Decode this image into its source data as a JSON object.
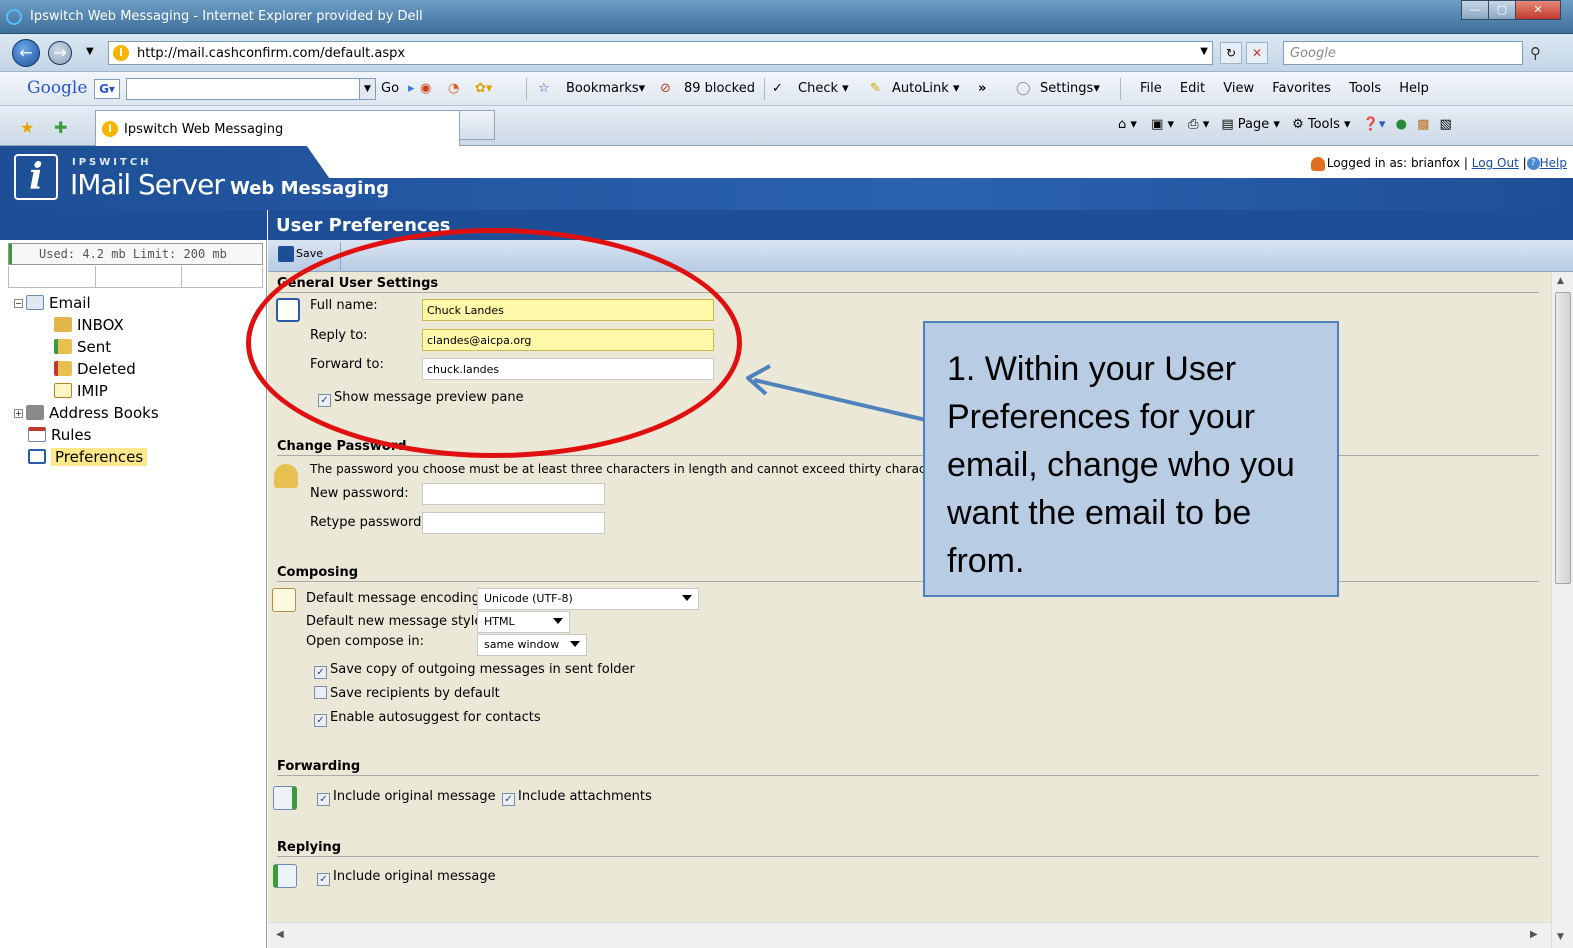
{
  "window": {
    "title": "Ipswitch Web Messaging - Internet Explorer provided by Dell",
    "url": "http://mail.cashconfirm.com/default.aspx",
    "search_placeholder": "Google",
    "tab_label": "Ipswitch Web Messaging"
  },
  "toolbar1": {
    "google_label": "Google",
    "go_label": "Go",
    "bookmarks_label": "Bookmarks",
    "blocked_label": "89 blocked",
    "check_label": "Check",
    "autolink_label": "AutoLink",
    "more_label": "»",
    "settings_label": "Settings",
    "menu": [
      "File",
      "Edit",
      "View",
      "Favorites",
      "Tools",
      "Help"
    ]
  },
  "toolbar2": {
    "page_label": "Page",
    "tools_label": "Tools"
  },
  "app": {
    "brand": "IPSWITCH",
    "product": "IMail Server",
    "subproduct": "Web Messaging",
    "logged_in_label": "Logged in as:",
    "username": "brianfox",
    "logout_label": "Log Out",
    "help_label": "Help"
  },
  "sidebar": {
    "quota_text": "Used: 4.2 mb Limit: 200 mb",
    "tree": [
      {
        "label": "Email",
        "icon": "envelope-icon",
        "level": 0,
        "expander": "−"
      },
      {
        "label": "INBOX",
        "icon": "inbox-icon",
        "level": 1
      },
      {
        "label": "Sent",
        "icon": "sent-folder-icon",
        "level": 1
      },
      {
        "label": "Deleted",
        "icon": "deleted-folder-icon",
        "level": 1
      },
      {
        "label": "IMIP",
        "icon": "folder-icon",
        "level": 1
      },
      {
        "label": "Address Books",
        "icon": "address-book-icon",
        "level": 0,
        "expander": "+"
      },
      {
        "label": "Rules",
        "icon": "rules-icon",
        "level": 0
      },
      {
        "label": "Preferences",
        "icon": "preferences-icon",
        "level": 0,
        "selected": true
      }
    ]
  },
  "main": {
    "title": "User Preferences",
    "save_label": "Save",
    "general": {
      "title": "General User Settings",
      "full_name_label": "Full name:",
      "full_name_value": "Chuck Landes",
      "reply_to_label": "Reply to:",
      "reply_to_value": "clandes@aicpa.org",
      "forward_to_label": "Forward to:",
      "forward_to_value": "chuck.landes",
      "preview_pane_label": "Show message preview pane"
    },
    "password": {
      "title": "Change Password",
      "hint": "The password you choose must be at least three characters in length and cannot exceed thirty characte",
      "new_label": "New password:",
      "retype_label": "Retype password:"
    },
    "composing": {
      "title": "Composing",
      "encoding_label": "Default message encoding:",
      "encoding_value": "Unicode (UTF-8)",
      "style_label": "Default new message style:",
      "style_value": "HTML",
      "open_label": "Open compose in:",
      "open_value": "same window",
      "save_copy_label": "Save copy of outgoing messages in sent folder",
      "save_recipients_label": "Save recipients by default",
      "autosuggest_label": "Enable autosuggest for contacts"
    },
    "forwarding": {
      "title": "Forwarding",
      "include_original_label": "Include original message",
      "include_attachments_label": "Include attachments"
    },
    "replying": {
      "title": "Replying",
      "include_original_label": "Include original message"
    }
  },
  "annotation": {
    "callout_text": "1. Within your User Preferences for your email, change who you want the email to be from.",
    "highlight_color": "#e01010",
    "callout_fill": "#b8cce4",
    "callout_border": "#4f81bd"
  },
  "colors": {
    "app_blue": "#1e4f96",
    "main_bg": "#ebe8d8",
    "field_highlight": "#fff8a8"
  }
}
